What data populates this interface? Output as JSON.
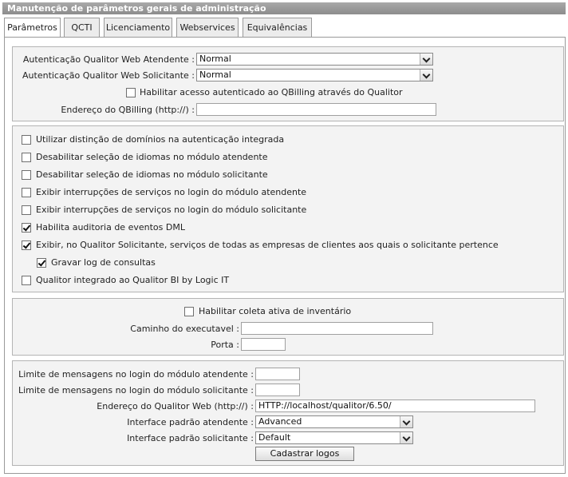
{
  "window": {
    "title": "Manutenção de parâmetros gerais de administração"
  },
  "tabs": [
    {
      "label": "Parâmetros",
      "active": true
    },
    {
      "label": "QCTI"
    },
    {
      "label": "Licenciamento"
    },
    {
      "label": "Webservices"
    },
    {
      "label": "Equivalências"
    }
  ],
  "auth": {
    "atendente_label": "Autenticação Qualitor Web Atendente :",
    "atendente_value": "Normal",
    "solicitante_label": "Autenticação Qualitor Web Solicitante :",
    "solicitante_value": "Normal",
    "qbilling_access_label": "Habilitar acesso autenticado ao QBilling através do Qualitor",
    "qbilling_access_checked": false,
    "qbilling_address_label": "Endereço do QBilling (http://) :",
    "qbilling_address_value": ""
  },
  "options": [
    {
      "label": "Utilizar distinção de domínios na autenticação integrada",
      "checked": false
    },
    {
      "label": "Desabilitar seleção de idiomas no módulo atendente",
      "checked": false
    },
    {
      "label": "Desabilitar seleção de idiomas no módulo solicitante",
      "checked": false
    },
    {
      "label": "Exibir interrupções de serviços no login do módulo atendente",
      "checked": false
    },
    {
      "label": "Exibir interrupções de serviços no login do módulo solicitante",
      "checked": false
    },
    {
      "label": "Habilita auditoria de eventos DML",
      "checked": true
    },
    {
      "label": "Exibir, no Qualitor Solicitante, serviços de todas as empresas de clientes aos quais o solicitante pertence",
      "checked": true
    },
    {
      "label": "Gravar log de consultas",
      "checked": true
    },
    {
      "label": "Qualitor integrado ao Qualitor BI by Logic IT",
      "checked": false
    }
  ],
  "inventory": {
    "active_collect_label": "Habilitar coleta ativa de inventário",
    "active_collect_checked": false,
    "exec_path_label": "Caminho do executavel :",
    "exec_path_value": "",
    "port_label": "Porta :",
    "port_value": ""
  },
  "web": {
    "msg_limit_atendente_label": "Limite de mensagens no login do módulo atendente :",
    "msg_limit_atendente_value": "",
    "msg_limit_solicitante_label": "Limite de mensagens no login do módulo solicitante :",
    "msg_limit_solicitante_value": "",
    "address_label": "Endereço do Qualitor Web (http://) :",
    "address_value": "HTTP://localhost/qualitor/6.50/",
    "iface_atendente_label": "Interface padrão atendente :",
    "iface_atendente_value": "Advanced",
    "iface_solicitante_label": "Interface padrão solicitante :",
    "iface_solicitante_value": "Default",
    "register_logos_label": "Cadastrar logos"
  }
}
